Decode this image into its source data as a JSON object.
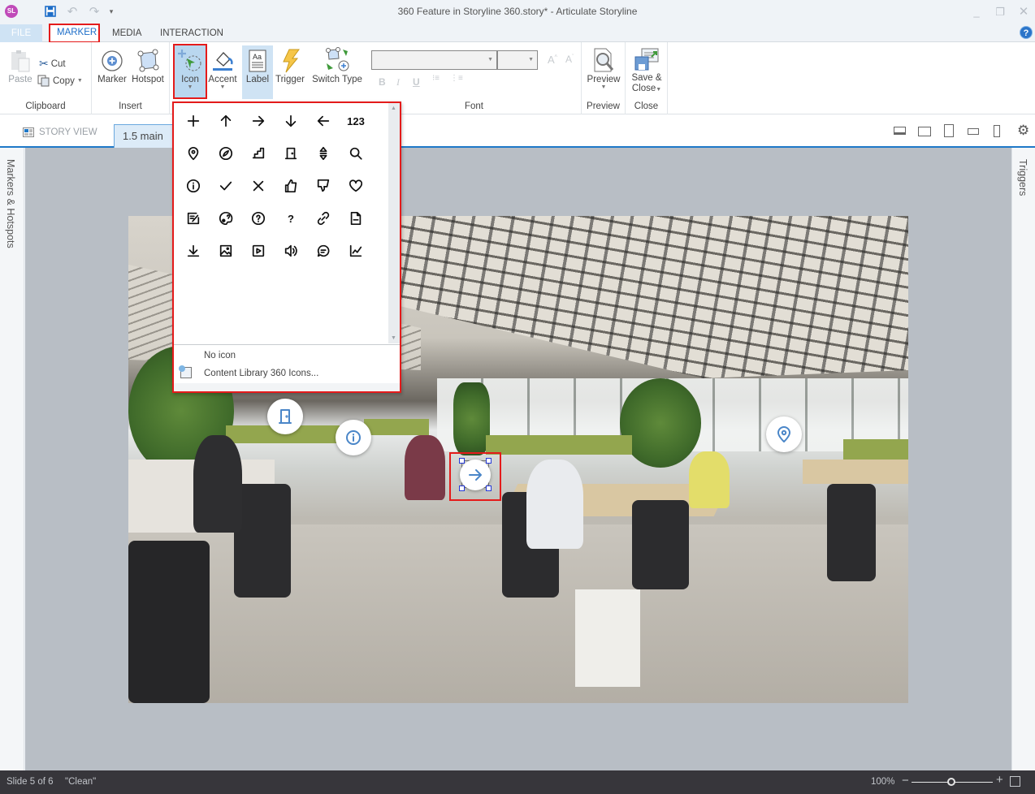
{
  "window": {
    "title": "360 Feature in Storyline 360.story* -  Articulate Storyline",
    "app_logo": "SL",
    "quick_access": [
      "save-icon",
      "undo-icon",
      "redo-icon",
      "customize-icon"
    ],
    "controls": [
      "minimize",
      "restore",
      "close"
    ]
  },
  "ribbon_tabs": {
    "file": "FILE",
    "marker": "MARKER",
    "media": "MEDIA",
    "interaction": "INTERACTION",
    "active": "MARKER"
  },
  "ribbon": {
    "clipboard": {
      "label": "Clipboard",
      "paste": "Paste",
      "cut": "Cut",
      "copy": "Copy"
    },
    "insert": {
      "label": "Insert",
      "marker": "Marker",
      "hotspot": "Hotspot"
    },
    "marker_tools": {
      "icon": "Icon",
      "accent": "Accent",
      "label": "Label",
      "trigger": "Trigger",
      "switch_type": "Switch Type"
    },
    "font": {
      "label": "Font",
      "font_name": "",
      "font_size": "",
      "bold": "B",
      "italic": "I",
      "underline": "U"
    },
    "preview": {
      "label": "Preview",
      "button": "Preview"
    },
    "close": {
      "label": "Close",
      "button_line1": "Save &",
      "button_line2": "Close"
    }
  },
  "story_strip": {
    "story_view": "STORY VIEW",
    "slide_tab": "1.5 main",
    "devices": [
      "desktop",
      "tablet-landscape",
      "tablet-portrait",
      "phone-landscape",
      "phone-portrait"
    ]
  },
  "side_panels": {
    "left": "Markers & Hotspots",
    "right": "Triggers"
  },
  "icon_dropdown": {
    "icons": [
      "plus",
      "arrow-up",
      "arrow-right",
      "arrow-down",
      "arrow-left",
      "numbers",
      "location-pin",
      "compass",
      "stairs",
      "door",
      "expand-vertical",
      "search",
      "info",
      "checkmark",
      "close-x",
      "thumbs-up",
      "thumbs-down",
      "heart",
      "edit-note",
      "palette",
      "question-circle",
      "question",
      "link",
      "document",
      "download",
      "image",
      "video-play",
      "audio",
      "chat-bubble",
      "line-chart"
    ],
    "numbers_label": "123",
    "question_label": "?",
    "no_icon": "No icon",
    "content_library": "Content Library 360 Icons..."
  },
  "canvas": {
    "markers": [
      "door",
      "info",
      "arrow-right",
      "location-pin"
    ],
    "selected_marker": "arrow-right",
    "accent_color": "#4a86c8"
  },
  "status": {
    "slide": "Slide 5 of 6",
    "theme": "\"Clean\"",
    "zoom": "100%",
    "zoom_fraction": 0.5
  },
  "colors": {
    "highlight_box": "#e41b1b",
    "accent_blue": "#1e78c8",
    "status_bar": "#37363b"
  }
}
